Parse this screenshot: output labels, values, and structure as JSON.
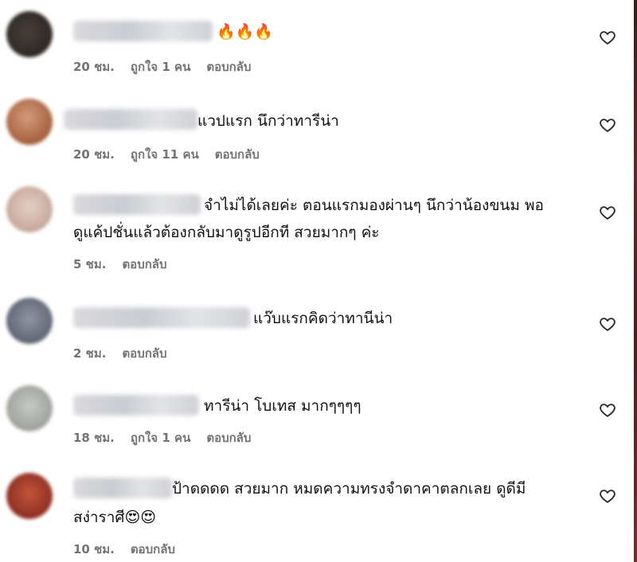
{
  "comments": [
    {
      "text": "🔥🔥🔥",
      "meta": {
        "time": "20 ชม.",
        "likes": "ถูกใจ 1 คน",
        "reply": "ตอบกลับ"
      }
    },
    {
      "text": "แวปแรก นึกว่าทารีน่า",
      "meta": {
        "time": "20 ชม.",
        "likes": "ถูกใจ 11 คน",
        "reply": "ตอบกลับ"
      }
    },
    {
      "text_line1": "จำไม่ได้เลยค่ะ ตอนแรกมองผ่านๆ นึกว่าน้องขนม พอ",
      "text_line2": "ดูแค้ปชั่นแล้วต้องกลับมาดูรูปอีกที สวยมากๆ ค่ะ",
      "meta": {
        "time": "5 ชม.",
        "reply": "ตอบกลับ"
      }
    },
    {
      "text": "แว๊บแรกคิดว่าทานีน่า",
      "meta": {
        "time": "2 ชม.",
        "reply": "ตอบกลับ"
      }
    },
    {
      "text": "ทารีน่า โบเทส มากๆๆๆๆ",
      "meta": {
        "time": "18 ชม.",
        "likes": "ถูกใจ 1 คน",
        "reply": "ตอบกลับ"
      }
    },
    {
      "text_line1": "ป้าดดดด สวยมาก หมดความทรงจำดาคาตลกเลย ดูดีมี",
      "text_line2": "สง่าราศี😍😍",
      "meta": {
        "time": "10 ชม.",
        "reply": "ตอบกลับ"
      }
    }
  ],
  "icons": {
    "like": "heart-outline-icon"
  },
  "colors": {
    "meta": "#737373",
    "text": "#111111",
    "background": "#ffffff"
  }
}
